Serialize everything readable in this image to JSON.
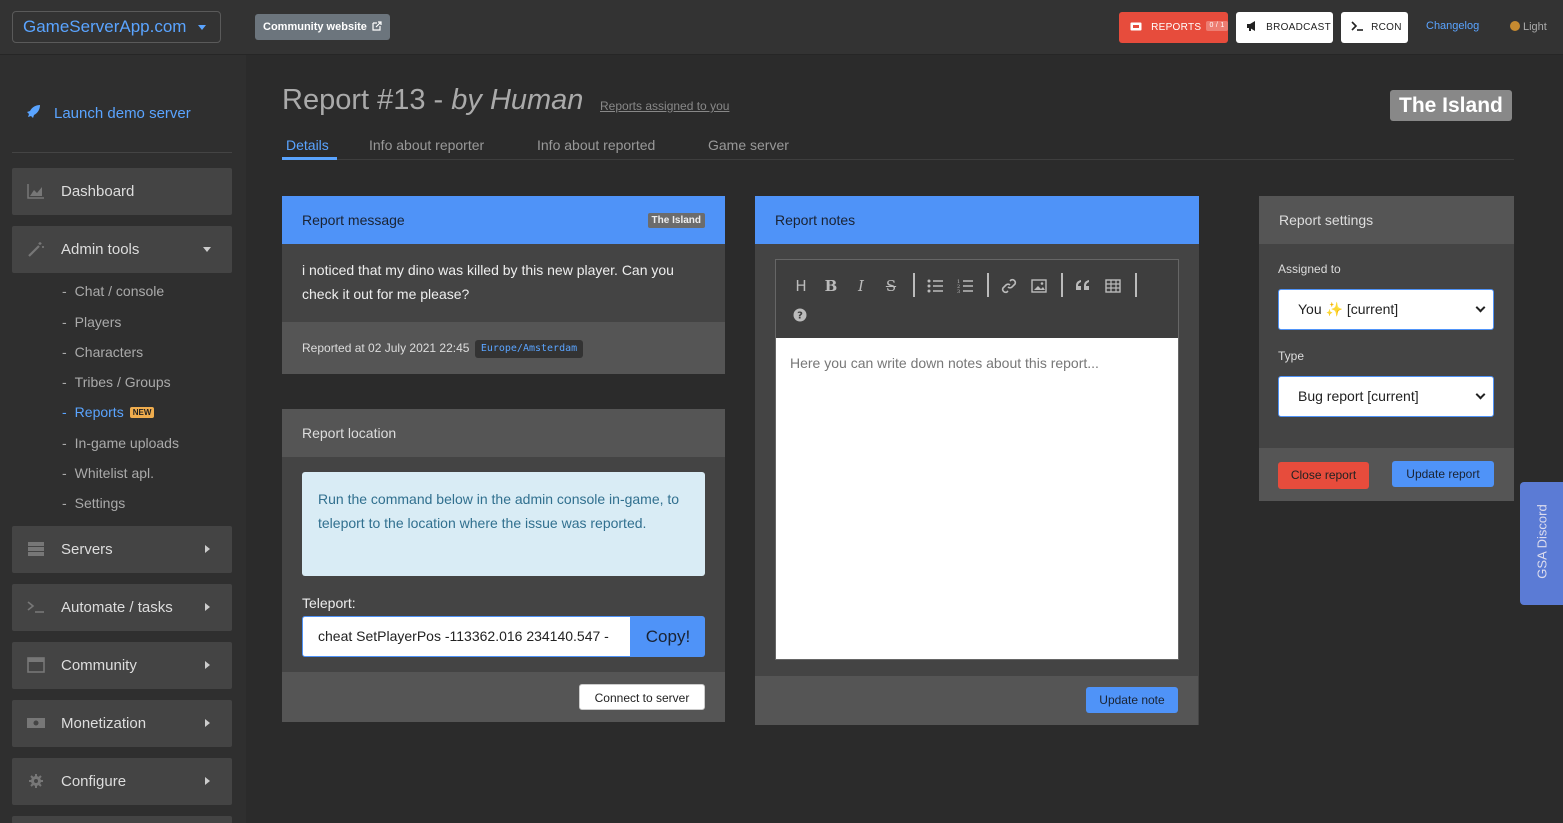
{
  "topbar": {
    "brand": "GameServerApp.com",
    "community_website": "Community website",
    "reports_label": "REPORTS",
    "reports_badge": "0 / 1",
    "broadcast_label": "BROADCAST",
    "rcon_label": "RCON",
    "changelog": "Changelog",
    "theme_toggle": "Light"
  },
  "sidebar": {
    "launch": "Launch demo server",
    "items": {
      "dashboard": "Dashboard",
      "admin_tools": "Admin tools",
      "servers": "Servers",
      "automate": "Automate / tasks",
      "community": "Community",
      "monetization": "Monetization",
      "configure": "Configure"
    },
    "sub_items": [
      "Chat / console",
      "Players",
      "Characters",
      "Tribes / Groups",
      "Reports",
      "In-game uploads",
      "Whitelist apl.",
      "Settings"
    ],
    "new_badge": "NEW"
  },
  "header": {
    "title_main": "Report #13 -",
    "title_by": "by Human",
    "assigned_link": "Reports assigned to you",
    "map": "The Island"
  },
  "tabs": [
    "Details",
    "Info about reporter",
    "Info about reported",
    "Game server"
  ],
  "report_message": {
    "title": "Report message",
    "map_badge": "The Island",
    "text": "i noticed that my dino was killed by this new player. Can you check it out for me please?",
    "reported_at": "Reported at 02 July 2021 22:45",
    "timezone": "Europe/Amsterdam"
  },
  "report_location": {
    "title": "Report location",
    "info": "Run the command below in the admin console in-game, to teleport to the location where the issue was reported.",
    "teleport_label": "Teleport:",
    "teleport_value": "cheat SetPlayerPos -113362.016 234140.547 -",
    "copy_label": "Copy!",
    "connect_label": "Connect to server"
  },
  "report_notes": {
    "title": "Report notes",
    "placeholder": "Here you can write down notes about this report...",
    "update_label": "Update note"
  },
  "report_settings": {
    "title": "Report settings",
    "assigned_label": "Assigned to",
    "assigned_value": "You ✨ [current]",
    "type_label": "Type",
    "type_value": "Bug report [current]",
    "close_label": "Close report",
    "update_label": "Update report"
  },
  "discord_tab": "GSA Discord",
  "colors": {
    "accent": "#4f93f8",
    "danger": "#e74c3c",
    "link": "#5aa4ff"
  }
}
